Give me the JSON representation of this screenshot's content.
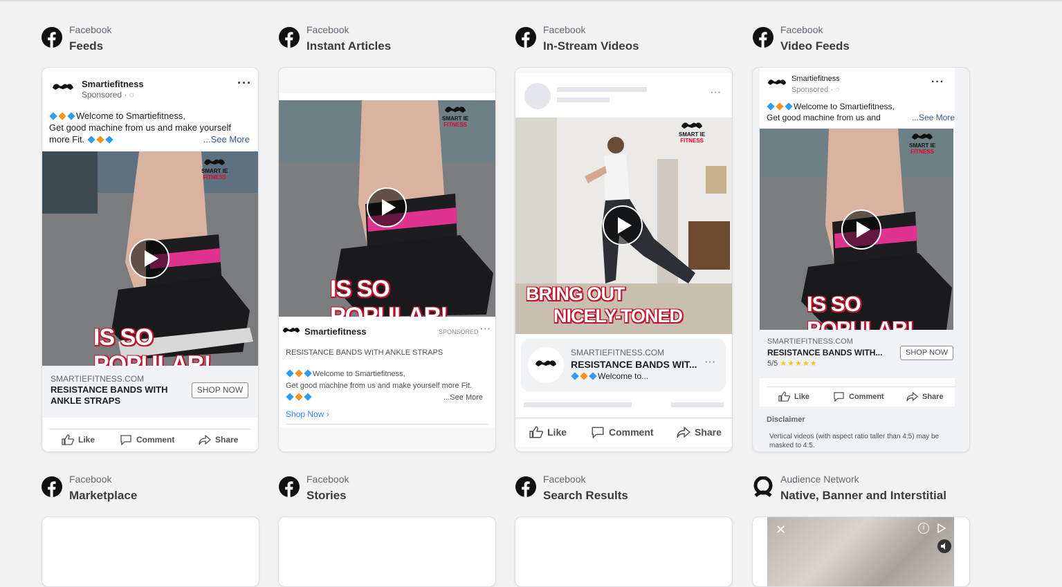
{
  "placements": [
    {
      "platform": "Facebook",
      "name": "Feeds"
    },
    {
      "platform": "Facebook",
      "name": "Instant Articles"
    },
    {
      "platform": "Facebook",
      "name": "In-Stream Videos"
    },
    {
      "platform": "Facebook",
      "name": "Video Feeds"
    },
    {
      "platform": "Facebook",
      "name": "Marketplace"
    },
    {
      "platform": "Facebook",
      "name": "Stories"
    },
    {
      "platform": "Facebook",
      "name": "Search Results"
    },
    {
      "platform": "Audience Network",
      "name": "Native, Banner and Interstitial"
    }
  ],
  "ad": {
    "page_name": "Smartiefitness",
    "sponsored": "Sponsored",
    "sponsored_upper": "SPONSORED",
    "text_line1": "Welcome to Smartiefitness,",
    "text_line1_comma": "Welcome to Smartiefitness,",
    "text_line2": "Get good machine from us and make yourself",
    "text_line3": "more Fit.",
    "text_line2_vf": "Get good machine from us and",
    "text_line2_full": "Get good machine from us and make yourself more Fit.",
    "see_more": "...See More",
    "see_more_alt": "...See More",
    "see_more_vf": "...See More",
    "domain": "SMARTIEFITNESS.COM",
    "headline": "RESISTANCE BANDS WITH ANKLE STRAPS",
    "headline_line1": "RESISTANCE BANDS WITH",
    "headline_line2": "ANKLE STRAPS",
    "headline_trunc": "RESISTANCE BANDS WIT...",
    "headline_trunc_vf": "RESISTANCE BANDS WITH...",
    "welcome_trunc": "Welcome to...",
    "rating": "5/5",
    "cta": "SHOP NOW",
    "shop_now_link": "Shop Now",
    "overlay_popular": "IS SO POPULAR!",
    "overlay_bring1": "BRING OUT",
    "overlay_bring2": "NICELY-TONED",
    "logo_line1": "SMART IE",
    "logo_line2": "FITNESS"
  },
  "actions": {
    "like": "Like",
    "comment": "Comment",
    "share": "Share"
  },
  "disclaimer": {
    "title": "Disclaimer",
    "body": "Vertical videos (with aspect ratio taller than 4:5) may be masked to 4:5."
  },
  "colors": {
    "background": "#f2f2f2",
    "link": "#385898",
    "overlay_outline": "#c0152f",
    "strap_pink": "#e0338f"
  }
}
